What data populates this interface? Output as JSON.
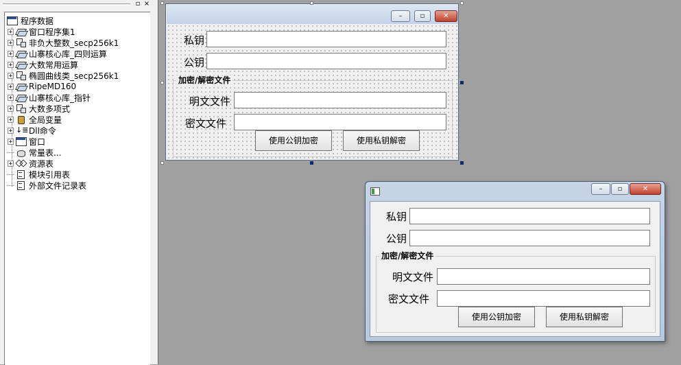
{
  "tree": {
    "panel_buttons": {
      "restore": "▫",
      "close": "×"
    },
    "root_label": "程序数据",
    "items": [
      {
        "label": "窗口程序集1",
        "icon": "book-icon",
        "expandable": true,
        "selected": true
      },
      {
        "label": "非负大整数_secp256k1",
        "icon": "class-icon",
        "expandable": true
      },
      {
        "label": "山寨核心库_四则运算",
        "icon": "book-icon",
        "expandable": true
      },
      {
        "label": "大数常用运算",
        "icon": "book-icon",
        "expandable": true
      },
      {
        "label": "椭圆曲线类_secp256k1",
        "icon": "class-icon",
        "expandable": true
      },
      {
        "label": "RipeMD160",
        "icon": "book-icon",
        "expandable": true
      },
      {
        "label": "山寨核心库_指针",
        "icon": "class-icon",
        "expandable": true
      },
      {
        "label": "大数多项式",
        "icon": "class-icon",
        "expandable": true
      },
      {
        "label": "全局变量",
        "icon": "global-icon",
        "expandable": true
      },
      {
        "label": "Dll命令",
        "icon": "dll-icon",
        "expandable": true
      },
      {
        "label": "窗口",
        "icon": "window-icon",
        "expandable": true
      },
      {
        "label": "常量表...",
        "icon": "constant-icon",
        "expandable": false
      },
      {
        "label": "资源表",
        "icon": "resource-icon",
        "expandable": true
      },
      {
        "label": "模块引用表",
        "icon": "module-ref-icon",
        "expandable": false
      },
      {
        "label": "外部文件记录表",
        "icon": "file-record-icon",
        "expandable": false
      }
    ]
  },
  "window_buttons": {
    "minimize": "–",
    "maximize": "▫",
    "close": "✕"
  },
  "form": {
    "private_key_label": "私钥",
    "private_key_value": "",
    "public_key_label": "公钥",
    "public_key_value": "",
    "group_title": "加密/解密文件",
    "plain_file_label": "明文文件",
    "plain_file_value": "",
    "cipher_file_label": "密文文件",
    "cipher_file_value": "",
    "encrypt_button": "使用公钥加密",
    "decrypt_button": "使用私钥解密"
  },
  "colors": {
    "workspace": "#a0a0a0",
    "selection_handle": "#102a70",
    "close_button": "#c0412f"
  }
}
